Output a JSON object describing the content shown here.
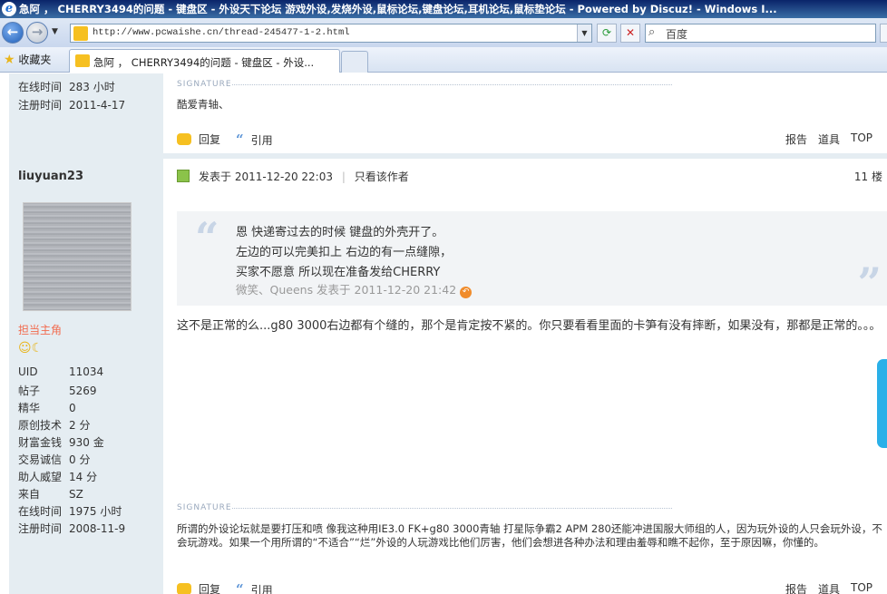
{
  "window": {
    "title": "急阿 ， CHERRY3494的问题 - 键盘区 - 外设天下论坛 游戏外设,发烧外设,鼠标论坛,键盘论坛,耳机论坛,鼠标垫论坛 - Powered by Discuz! - Windows I..."
  },
  "browser": {
    "url": "http://www.pcwaishe.cn/thread-245477-1-2.html",
    "search_placeholder": "百度",
    "favorites_label": "收藏夹",
    "tab_title": "急阿 ， CHERRY3494的问题 - 键盘区 - 外设..."
  },
  "prev_post": {
    "online_label": "在线时间",
    "online_value": "283 小时",
    "reg_label": "注册时间",
    "reg_value": "2011-4-17",
    "signature_label": "SIGNATURE",
    "signature": "酷爱青轴、",
    "actions": {
      "reply": "回复",
      "quote": "引用",
      "report": "报告",
      "tools": "道具",
      "top": "TOP"
    }
  },
  "post": {
    "author": "liuyuan23",
    "rank": "担当主角",
    "medal_glyphs": "☺☾",
    "stats": [
      {
        "label": "UID",
        "value": "11034"
      },
      {
        "label": "帖子",
        "value": "5269"
      },
      {
        "label": "精华",
        "value": "0"
      },
      {
        "label": "原创技术",
        "value": "2 分"
      },
      {
        "label": "财富金钱",
        "value": "930 金"
      },
      {
        "label": "交易诚信",
        "value": "0 分"
      },
      {
        "label": "助人威望",
        "value": "14 分"
      },
      {
        "label": "来自",
        "value": "SZ"
      },
      {
        "label": "在线时间",
        "value": "1975 小时"
      },
      {
        "label": "注册时间",
        "value": "2008-11-9"
      }
    ],
    "posted_prefix": "发表于",
    "posted_time": "2011-12-20 22:03",
    "only_author": "只看该作者",
    "floor": "11 楼",
    "quote": {
      "lines": [
        "恩 快递寄过去的时候 键盘的外壳开了。",
        "左边的可以完美扣上 右边的有一点缝隙，",
        "买家不愿意 所以现在准备发给CHERRY"
      ],
      "meta": "微笑、Queens 发表于 2011-12-20 21:42"
    },
    "message": "这不是正常的么...g80 3000右边都有个缝的，那个是肯定按不紧的。你只要看看里面的卡笋有没有摔断，如果没有，那都是正常的。。。",
    "signature_label": "SIGNATURE",
    "signature": "所谓的外设论坛就是要打压和喷 像我这种用IE3.0 FK+g80 3000青轴 打星际争霸2 APM 280还能冲进国服大师组的人，因为玩外设的人只会玩外设，不会玩游戏。如果一个用所谓的“不适合”“烂”外设的人玩游戏比他们厉害，他们会想进各种办法和理由羞辱和瞧不起你，至于原因嘛，你懂的。",
    "actions": {
      "reply": "回复",
      "quote": "引用",
      "report": "报告",
      "tools": "道具",
      "top": "TOP"
    }
  }
}
